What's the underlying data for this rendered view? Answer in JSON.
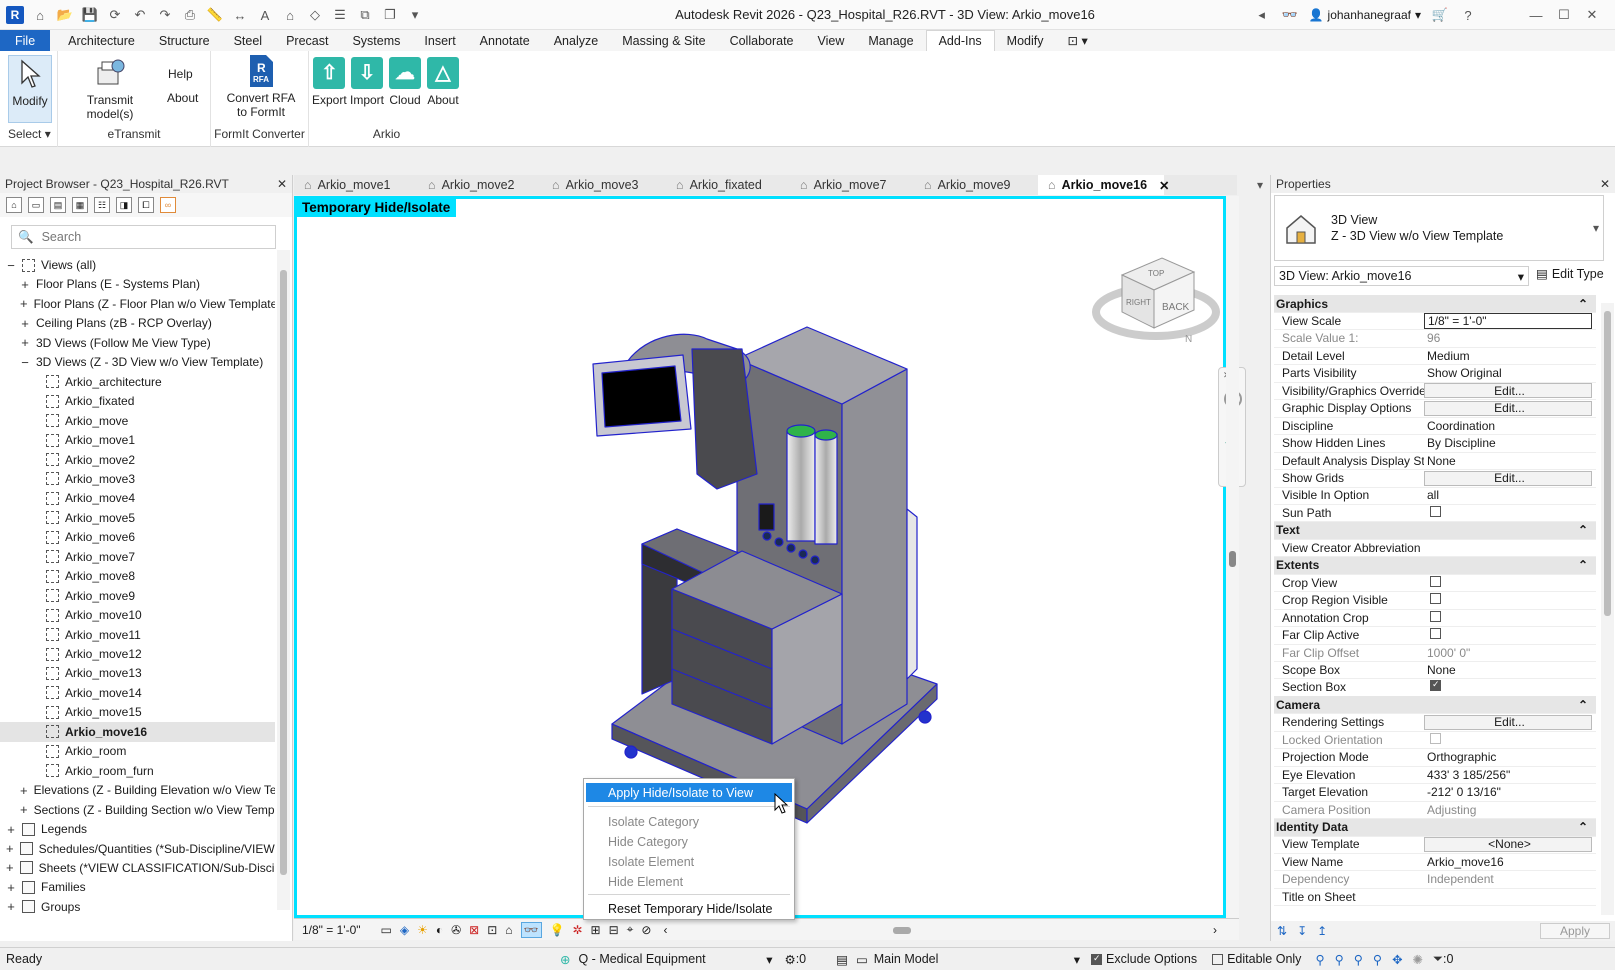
{
  "app": {
    "window_title": "Autodesk Revit 2026 - Q23_Hospital_R26.RVT - 3D View: Arkio_move16",
    "user": "johanhanegraaf",
    "logo_letter": "R"
  },
  "menu": [
    "File",
    "Architecture",
    "Structure",
    "Steel",
    "Precast",
    "Systems",
    "Insert",
    "Annotate",
    "Analyze",
    "Massing & Site",
    "Collaborate",
    "View",
    "Manage",
    "Add-Ins",
    "Modify"
  ],
  "ribbon": {
    "select": {
      "button": "Modify",
      "label": "Select"
    },
    "etransmit": {
      "button": "Transmit model(s)",
      "help": "Help",
      "about": "About",
      "label": "eTransmit"
    },
    "formit": {
      "button_line1": "Convert RFA",
      "button_line2": "to FormIt",
      "badge": "RFA",
      "label": "FormIt Converter"
    },
    "arkio": {
      "export": "Export",
      "import": "Import",
      "cloud": "Cloud",
      "about": "About",
      "label": "Arkio"
    }
  },
  "project_browser": {
    "title": "Project Browser - Q23_Hospital_R26.RVT",
    "search_placeholder": "Search",
    "items": [
      {
        "label": "Views (all)",
        "exp": "−",
        "indent": 0,
        "icon": "views"
      },
      {
        "label": "Floor Plans (E - Systems Plan)",
        "exp": "+",
        "indent": 1
      },
      {
        "label": "Floor Plans (Z - Floor Plan w/o View Template)",
        "exp": "+",
        "indent": 1
      },
      {
        "label": "Ceiling Plans (zB - RCP Overlay)",
        "exp": "+",
        "indent": 1
      },
      {
        "label": "3D Views (Follow Me View Type)",
        "exp": "+",
        "indent": 1
      },
      {
        "label": "3D Views (Z - 3D View w/o View Template)",
        "exp": "−",
        "indent": 1
      },
      {
        "label": "Arkio_architecture",
        "indent": 2,
        "icon": "view"
      },
      {
        "label": "Arkio_fixated",
        "indent": 2,
        "icon": "view"
      },
      {
        "label": "Arkio_move",
        "indent": 2,
        "icon": "view"
      },
      {
        "label": "Arkio_move1",
        "indent": 2,
        "icon": "view"
      },
      {
        "label": "Arkio_move2",
        "indent": 2,
        "icon": "view"
      },
      {
        "label": "Arkio_move3",
        "indent": 2,
        "icon": "view"
      },
      {
        "label": "Arkio_move4",
        "indent": 2,
        "icon": "view"
      },
      {
        "label": "Arkio_move5",
        "indent": 2,
        "icon": "view"
      },
      {
        "label": "Arkio_move6",
        "indent": 2,
        "icon": "view"
      },
      {
        "label": "Arkio_move7",
        "indent": 2,
        "icon": "view"
      },
      {
        "label": "Arkio_move8",
        "indent": 2,
        "icon": "view"
      },
      {
        "label": "Arkio_move9",
        "indent": 2,
        "icon": "view"
      },
      {
        "label": "Arkio_move10",
        "indent": 2,
        "icon": "view"
      },
      {
        "label": "Arkio_move11",
        "indent": 2,
        "icon": "view"
      },
      {
        "label": "Arkio_move12",
        "indent": 2,
        "icon": "view"
      },
      {
        "label": "Arkio_move13",
        "indent": 2,
        "icon": "view"
      },
      {
        "label": "Arkio_move14",
        "indent": 2,
        "icon": "view"
      },
      {
        "label": "Arkio_move15",
        "indent": 2,
        "icon": "view"
      },
      {
        "label": "Arkio_move16",
        "indent": 2,
        "icon": "view",
        "selected": true
      },
      {
        "label": "Arkio_room",
        "indent": 2,
        "icon": "view"
      },
      {
        "label": "Arkio_room_furn",
        "indent": 2,
        "icon": "view"
      },
      {
        "label": "Elevations (Z - Building Elevation w/o View Template)",
        "exp": "+",
        "indent": 1
      },
      {
        "label": "Sections (Z - Building Section w/o View Template)",
        "exp": "+",
        "indent": 1
      },
      {
        "label": "Legends",
        "exp": "+",
        "indent": 0,
        "icon": "table"
      },
      {
        "label": "Schedules/Quantities (*Sub-Discipline/VIEW CLASSIFICATION)",
        "exp": "+",
        "indent": 0,
        "icon": "table"
      },
      {
        "label": "Sheets (*VIEW CLASSIFICATION/Sub-Discipline)",
        "exp": "+",
        "indent": 0,
        "icon": "table"
      },
      {
        "label": "Families",
        "exp": "+",
        "indent": 0,
        "icon": "table"
      },
      {
        "label": "Groups",
        "exp": "+",
        "indent": 0,
        "icon": "table"
      }
    ]
  },
  "view_tabs": [
    "Arkio_move1",
    "Arkio_move2",
    "Arkio_move3",
    "Arkio_fixated",
    "Arkio_move7",
    "Arkio_move9",
    "Arkio_move16"
  ],
  "active_tab": "Arkio_move16",
  "viewport": {
    "banner": "Temporary Hide/Isolate",
    "viewcube": {
      "top": "TOP",
      "right": "RIGHT",
      "back": "BACK",
      "compass": "N"
    },
    "scale": "1/8\" = 1'-0\""
  },
  "context_menu": {
    "apply": "Apply Hide/Isolate to View",
    "isolate_category": "Isolate Category",
    "hide_category": "Hide Category",
    "isolate_element": "Isolate Element",
    "hide_element": "Hide Element",
    "reset": "Reset Temporary Hide/Isolate"
  },
  "properties": {
    "title": "Properties",
    "type_line1": "3D View",
    "type_line2": "Z - 3D View w/o View Template",
    "instance": "3D View: Arkio_move16",
    "edit_type": "Edit Type",
    "apply": "Apply",
    "rows": [
      {
        "sec": "Graphics"
      },
      {
        "n": "View Scale",
        "v": "1/8\" = 1'-0\"",
        "kind": "input"
      },
      {
        "n": "Scale Value    1:",
        "v": "96",
        "grey": true
      },
      {
        "n": "Detail Level",
        "v": "Medium"
      },
      {
        "n": "Parts Visibility",
        "v": "Show Original"
      },
      {
        "n": "Visibility/Graphics Overrides",
        "v": "Edit...",
        "kind": "btn"
      },
      {
        "n": "Graphic Display Options",
        "v": "Edit...",
        "kind": "btn"
      },
      {
        "n": "Discipline",
        "v": "Coordination"
      },
      {
        "n": "Show Hidden Lines",
        "v": "By Discipline"
      },
      {
        "n": "Default Analysis Display Style",
        "v": "None"
      },
      {
        "n": "Show Grids",
        "v": "Edit...",
        "kind": "btn"
      },
      {
        "n": "Visible In Option",
        "v": "all"
      },
      {
        "n": "Sun Path",
        "kind": "cb"
      },
      {
        "sec": "Text"
      },
      {
        "n": "View Creator Abbreviation",
        "v": ""
      },
      {
        "sec": "Extents"
      },
      {
        "n": "Crop View",
        "kind": "cb"
      },
      {
        "n": "Crop Region Visible",
        "kind": "cb"
      },
      {
        "n": "Annotation Crop",
        "kind": "cb"
      },
      {
        "n": "Far Clip Active",
        "kind": "cb"
      },
      {
        "n": "Far Clip Offset",
        "v": "1000'  0\"",
        "grey": true
      },
      {
        "n": "Scope Box",
        "v": "None"
      },
      {
        "n": "Section Box",
        "kind": "cb",
        "checked": true
      },
      {
        "sec": "Camera"
      },
      {
        "n": "Rendering Settings",
        "v": "Edit...",
        "kind": "btn"
      },
      {
        "n": "Locked Orientation",
        "kind": "cb",
        "grey": true
      },
      {
        "n": "Projection Mode",
        "v": "Orthographic"
      },
      {
        "n": "Eye Elevation",
        "v": "433'  3 185/256\""
      },
      {
        "n": "Target Elevation",
        "v": "-212'  0 13/16\""
      },
      {
        "n": "Camera Position",
        "v": "Adjusting",
        "grey": true
      },
      {
        "sec": "Identity Data"
      },
      {
        "n": "View Template",
        "v": "<None>",
        "kind": "btn"
      },
      {
        "n": "View Name",
        "v": "Arkio_move16"
      },
      {
        "n": "Dependency",
        "v": "Independent",
        "grey": true
      },
      {
        "n": "Title on Sheet",
        "v": ""
      }
    ]
  },
  "status": {
    "ready": "Ready",
    "workset": "Q - Medical Equipment",
    "count": ":0",
    "model": "Main Model",
    "exclude_options": "Exclude Options",
    "editable_only": "Editable Only",
    "filter_count": ":0"
  }
}
